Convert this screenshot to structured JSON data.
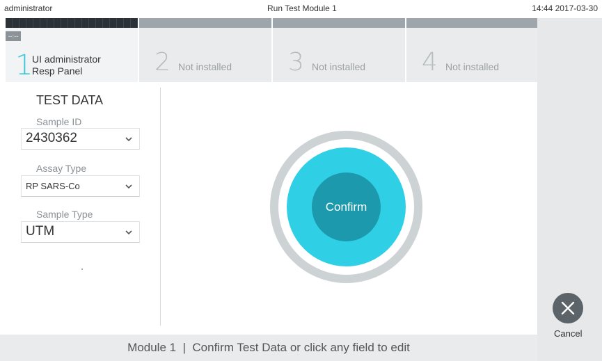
{
  "titlebar": {
    "user": "administrator",
    "title": "Run Test Module 1",
    "datetime": "14:44 2017-03-30"
  },
  "tabs": [
    {
      "number": "1",
      "line1": "UI administrator",
      "line2": "Resp Panel",
      "badge": "--:--",
      "active": true
    },
    {
      "number": "2",
      "label": "Not installed"
    },
    {
      "number": "3",
      "label": "Not installed"
    },
    {
      "number": "4",
      "label": "Not installed"
    }
  ],
  "test_data": {
    "title": "TEST DATA",
    "sample_id": {
      "label": "Sample ID",
      "value": "2430362"
    },
    "assay_type": {
      "label": "Assay Type",
      "value": "RP SARS-Co"
    },
    "sample_type": {
      "label": "Sample Type",
      "value": "UTM"
    }
  },
  "confirm_label": "Confirm",
  "cancel_label": "Cancel",
  "status_message": "Module 1  |  Confirm Test Data or click any field to edit",
  "colors": {
    "accent": "#2fd0e6",
    "confirm": "#1d99ad",
    "tab_active_number": "#3cc9d8",
    "cancel": "#5c6469"
  },
  "icons": {
    "cancel": "close-icon",
    "dropdown": "chevron-down-icon"
  }
}
